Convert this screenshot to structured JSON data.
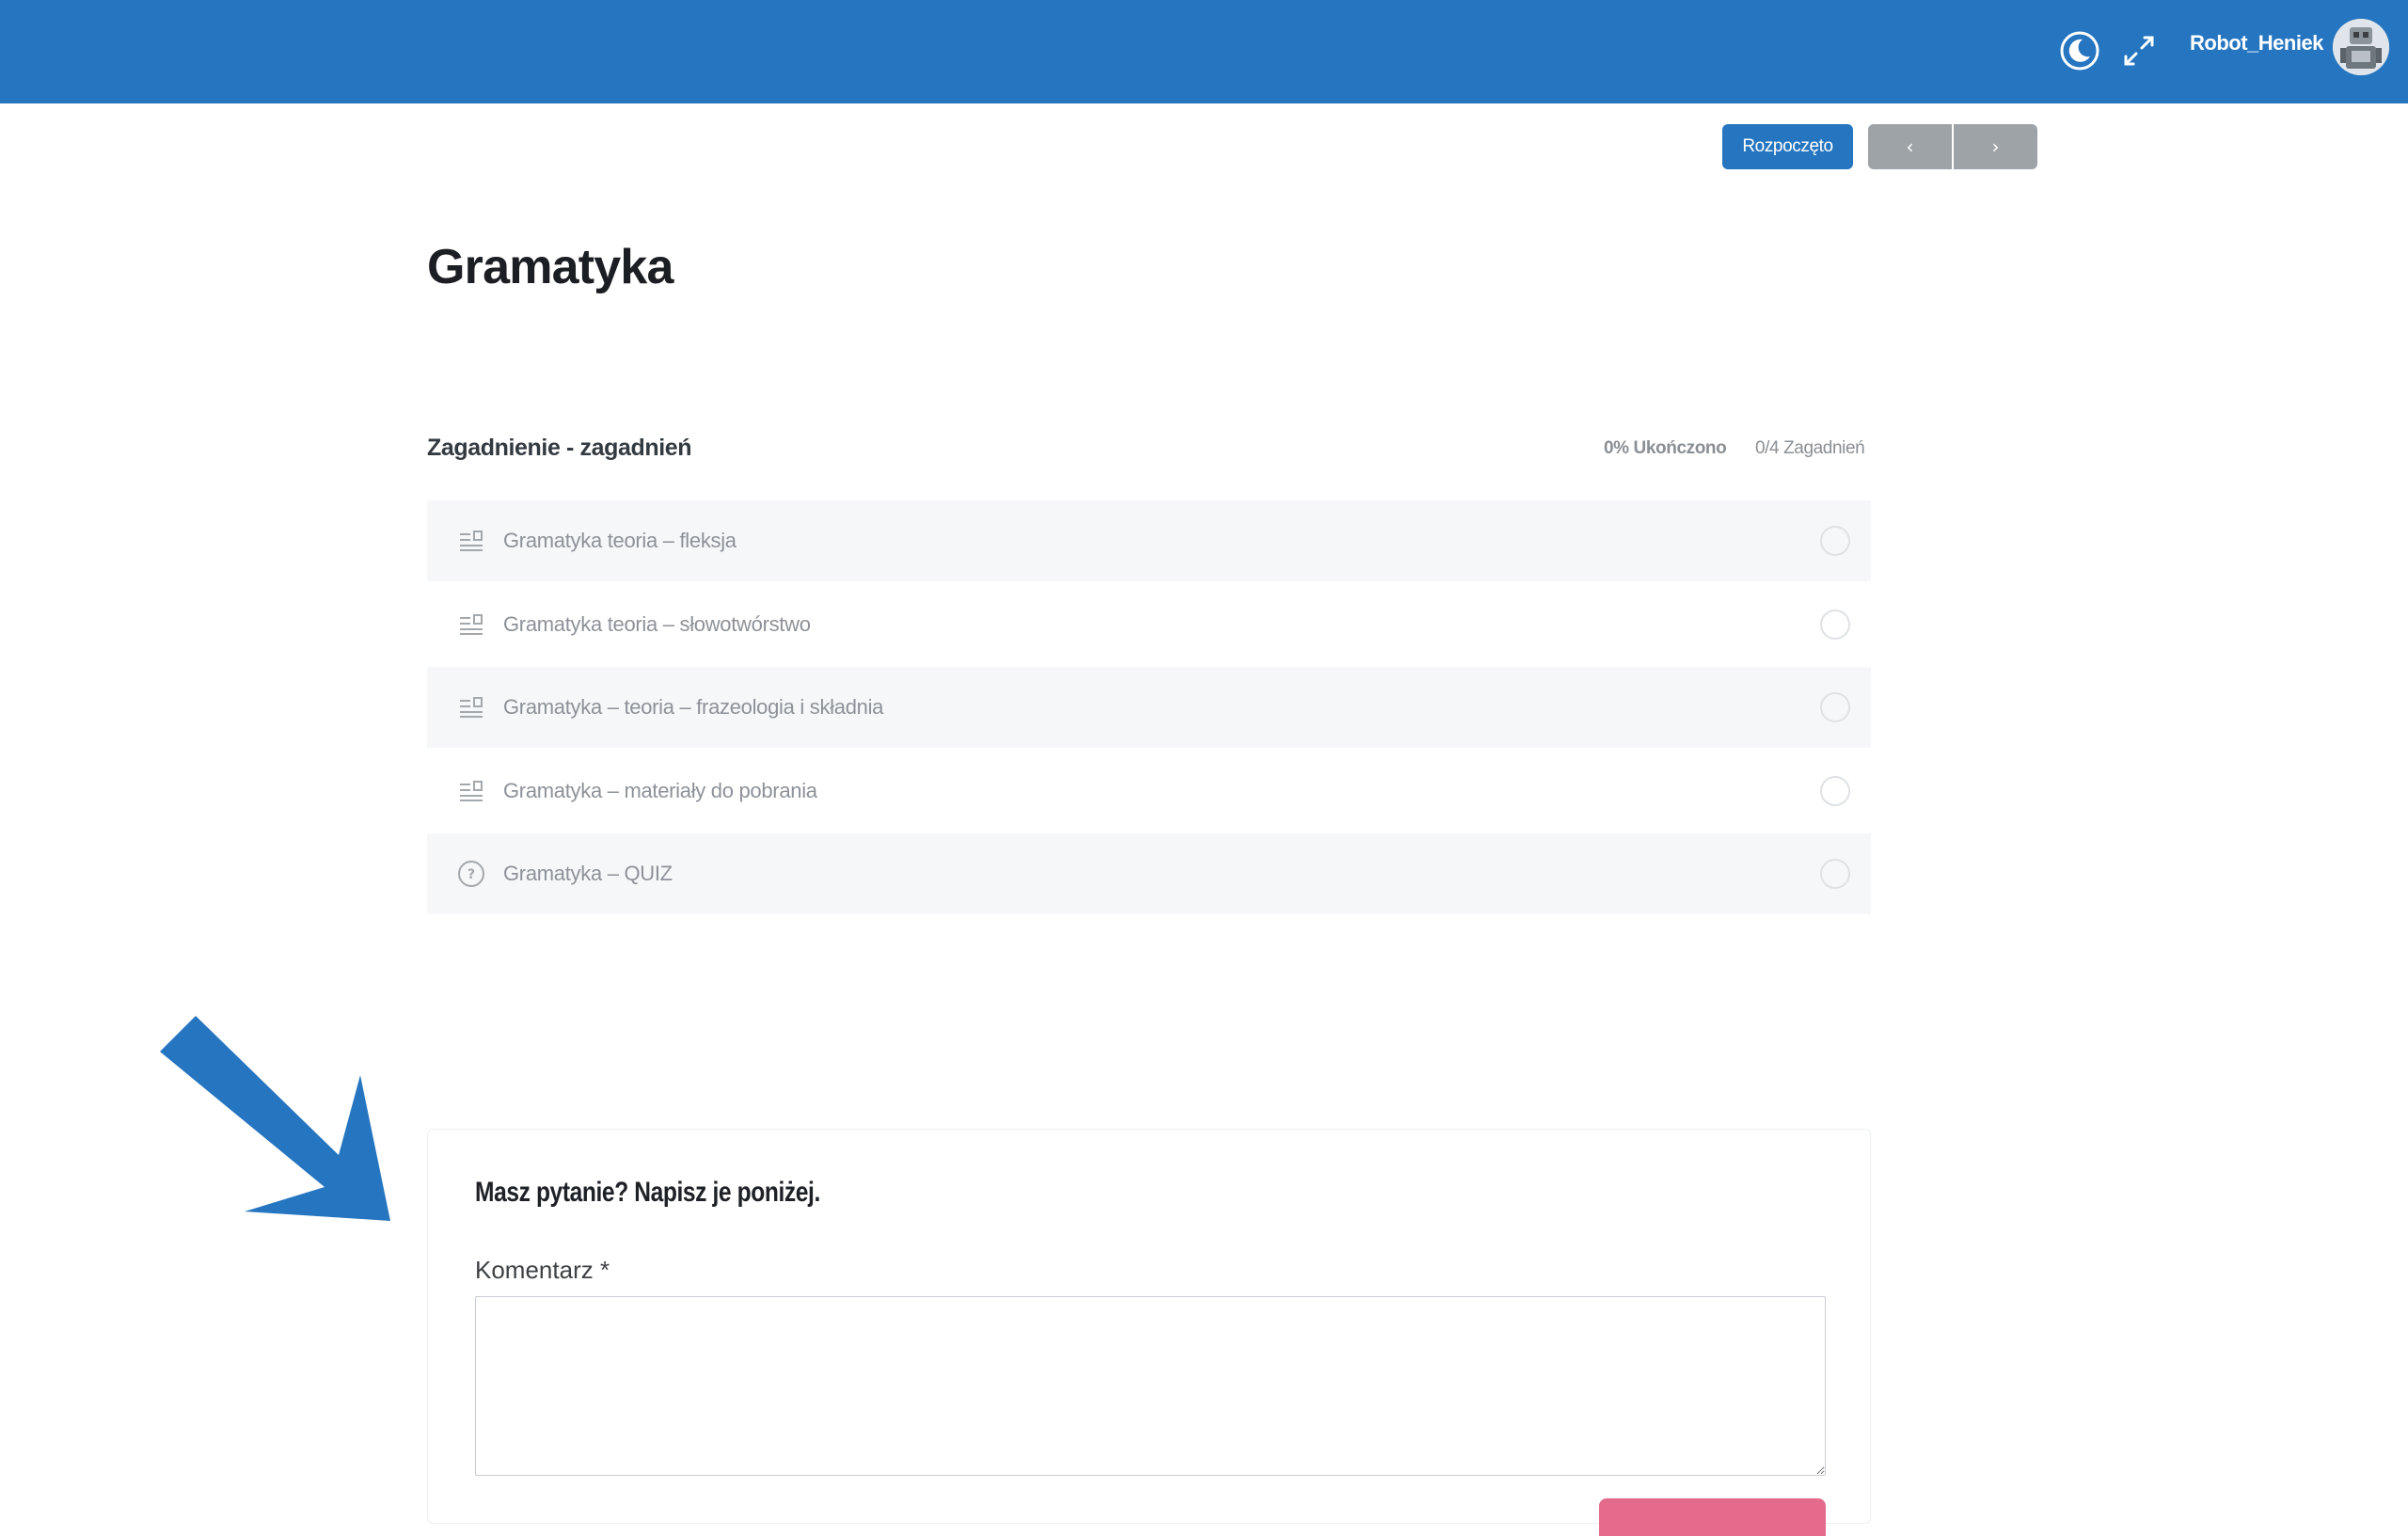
{
  "header": {
    "username": "Robot_Heniek",
    "icons": {
      "theme_toggle": "moon-icon",
      "fullscreen": "expand-icon",
      "avatar": "robot-avatar"
    },
    "colors": {
      "bar": "#2575c0"
    }
  },
  "lesson_nav": {
    "status_button": "Rozpoczęto",
    "prev_label": "‹",
    "next_label": "›"
  },
  "page": {
    "title": "Gramatyka"
  },
  "topics": {
    "section_title": "Zagadnienie - zagadnień",
    "progress_complete": "0% Ukończono",
    "progress_count": "0/4 Zagadnień",
    "items": [
      {
        "label": "Gramatyka teoria – fleksja",
        "icon": "text-lines-icon",
        "completed": false
      },
      {
        "label": "Gramatyka teoria – słowotwórstwo",
        "icon": "text-lines-icon",
        "completed": false
      },
      {
        "label": "Gramatyka – teoria – frazeologia i składnia",
        "icon": "text-lines-icon",
        "completed": false
      },
      {
        "label": "Gramatyka – materiały do pobrania",
        "icon": "text-lines-icon",
        "completed": false
      },
      {
        "label": "Gramatyka – QUIZ",
        "icon": "question-circle-icon",
        "completed": false
      }
    ]
  },
  "comment": {
    "heading": "Masz pytanie? Napisz je poniżej.",
    "label": "Komentarz *",
    "value": ""
  }
}
